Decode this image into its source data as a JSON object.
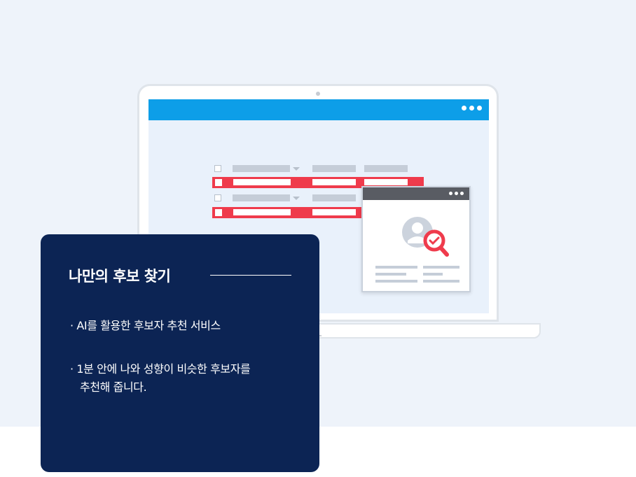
{
  "card": {
    "title": "나만의 후보 찾기",
    "bullets": [
      "· AI를 활용한 후보자 추천 서비스",
      "· 1분 안에 나와 성향이 비슷한 후보자를",
      "추천해 줍니다."
    ]
  },
  "illustration": {
    "browser_accent": "#0d9ee8",
    "highlight_color": "#ef3b4c",
    "card_color": "#0c2454",
    "icons": [
      "browser-dots-icon",
      "user-profile-icon",
      "magnifier-check-icon"
    ]
  }
}
